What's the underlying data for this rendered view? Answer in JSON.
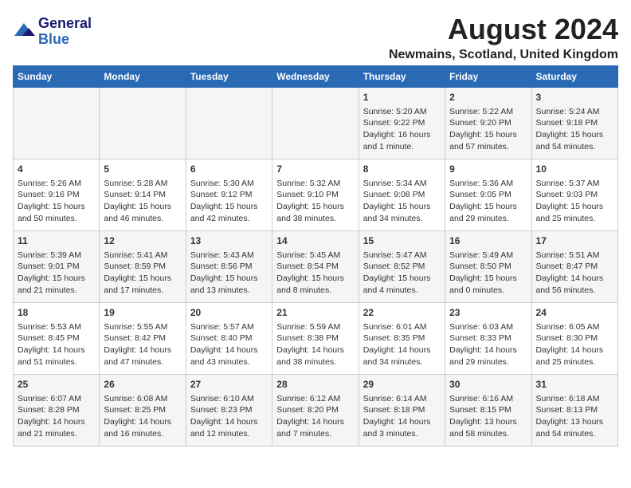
{
  "header": {
    "logo_line1": "General",
    "logo_line2": "Blue",
    "main_title": "August 2024",
    "subtitle": "Newmains, Scotland, United Kingdom"
  },
  "calendar": {
    "days_of_week": [
      "Sunday",
      "Monday",
      "Tuesday",
      "Wednesday",
      "Thursday",
      "Friday",
      "Saturday"
    ],
    "weeks": [
      [
        {
          "day": "",
          "info": ""
        },
        {
          "day": "",
          "info": ""
        },
        {
          "day": "",
          "info": ""
        },
        {
          "day": "",
          "info": ""
        },
        {
          "day": "1",
          "info": "Sunrise: 5:20 AM\nSunset: 9:22 PM\nDaylight: 16 hours\nand 1 minute."
        },
        {
          "day": "2",
          "info": "Sunrise: 5:22 AM\nSunset: 9:20 PM\nDaylight: 15 hours\nand 57 minutes."
        },
        {
          "day": "3",
          "info": "Sunrise: 5:24 AM\nSunset: 9:18 PM\nDaylight: 15 hours\nand 54 minutes."
        }
      ],
      [
        {
          "day": "4",
          "info": "Sunrise: 5:26 AM\nSunset: 9:16 PM\nDaylight: 15 hours\nand 50 minutes."
        },
        {
          "day": "5",
          "info": "Sunrise: 5:28 AM\nSunset: 9:14 PM\nDaylight: 15 hours\nand 46 minutes."
        },
        {
          "day": "6",
          "info": "Sunrise: 5:30 AM\nSunset: 9:12 PM\nDaylight: 15 hours\nand 42 minutes."
        },
        {
          "day": "7",
          "info": "Sunrise: 5:32 AM\nSunset: 9:10 PM\nDaylight: 15 hours\nand 38 minutes."
        },
        {
          "day": "8",
          "info": "Sunrise: 5:34 AM\nSunset: 9:08 PM\nDaylight: 15 hours\nand 34 minutes."
        },
        {
          "day": "9",
          "info": "Sunrise: 5:36 AM\nSunset: 9:05 PM\nDaylight: 15 hours\nand 29 minutes."
        },
        {
          "day": "10",
          "info": "Sunrise: 5:37 AM\nSunset: 9:03 PM\nDaylight: 15 hours\nand 25 minutes."
        }
      ],
      [
        {
          "day": "11",
          "info": "Sunrise: 5:39 AM\nSunset: 9:01 PM\nDaylight: 15 hours\nand 21 minutes."
        },
        {
          "day": "12",
          "info": "Sunrise: 5:41 AM\nSunset: 8:59 PM\nDaylight: 15 hours\nand 17 minutes."
        },
        {
          "day": "13",
          "info": "Sunrise: 5:43 AM\nSunset: 8:56 PM\nDaylight: 15 hours\nand 13 minutes."
        },
        {
          "day": "14",
          "info": "Sunrise: 5:45 AM\nSunset: 8:54 PM\nDaylight: 15 hours\nand 8 minutes."
        },
        {
          "day": "15",
          "info": "Sunrise: 5:47 AM\nSunset: 8:52 PM\nDaylight: 15 hours\nand 4 minutes."
        },
        {
          "day": "16",
          "info": "Sunrise: 5:49 AM\nSunset: 8:50 PM\nDaylight: 15 hours\nand 0 minutes."
        },
        {
          "day": "17",
          "info": "Sunrise: 5:51 AM\nSunset: 8:47 PM\nDaylight: 14 hours\nand 56 minutes."
        }
      ],
      [
        {
          "day": "18",
          "info": "Sunrise: 5:53 AM\nSunset: 8:45 PM\nDaylight: 14 hours\nand 51 minutes."
        },
        {
          "day": "19",
          "info": "Sunrise: 5:55 AM\nSunset: 8:42 PM\nDaylight: 14 hours\nand 47 minutes."
        },
        {
          "day": "20",
          "info": "Sunrise: 5:57 AM\nSunset: 8:40 PM\nDaylight: 14 hours\nand 43 minutes."
        },
        {
          "day": "21",
          "info": "Sunrise: 5:59 AM\nSunset: 8:38 PM\nDaylight: 14 hours\nand 38 minutes."
        },
        {
          "day": "22",
          "info": "Sunrise: 6:01 AM\nSunset: 8:35 PM\nDaylight: 14 hours\nand 34 minutes."
        },
        {
          "day": "23",
          "info": "Sunrise: 6:03 AM\nSunset: 8:33 PM\nDaylight: 14 hours\nand 29 minutes."
        },
        {
          "day": "24",
          "info": "Sunrise: 6:05 AM\nSunset: 8:30 PM\nDaylight: 14 hours\nand 25 minutes."
        }
      ],
      [
        {
          "day": "25",
          "info": "Sunrise: 6:07 AM\nSunset: 8:28 PM\nDaylight: 14 hours\nand 21 minutes."
        },
        {
          "day": "26",
          "info": "Sunrise: 6:08 AM\nSunset: 8:25 PM\nDaylight: 14 hours\nand 16 minutes."
        },
        {
          "day": "27",
          "info": "Sunrise: 6:10 AM\nSunset: 8:23 PM\nDaylight: 14 hours\nand 12 minutes."
        },
        {
          "day": "28",
          "info": "Sunrise: 6:12 AM\nSunset: 8:20 PM\nDaylight: 14 hours\nand 7 minutes."
        },
        {
          "day": "29",
          "info": "Sunrise: 6:14 AM\nSunset: 8:18 PM\nDaylight: 14 hours\nand 3 minutes."
        },
        {
          "day": "30",
          "info": "Sunrise: 6:16 AM\nSunset: 8:15 PM\nDaylight: 13 hours\nand 58 minutes."
        },
        {
          "day": "31",
          "info": "Sunrise: 6:18 AM\nSunset: 8:13 PM\nDaylight: 13 hours\nand 54 minutes."
        }
      ]
    ]
  }
}
